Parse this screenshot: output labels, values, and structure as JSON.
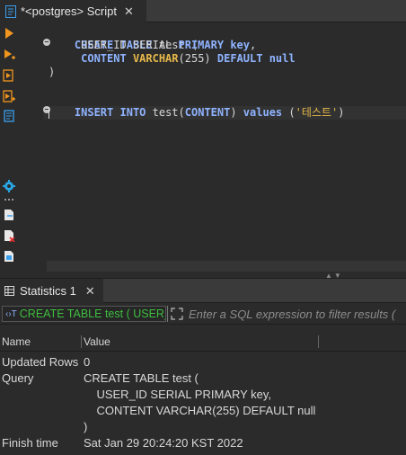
{
  "editor_tab": {
    "title": "*<postgres> Script",
    "close": "✕"
  },
  "toolbar": {
    "top": [
      "execute-statement-icon",
      "execute-in-new-tab-icon",
      "execute-script-icon",
      "execute-script-new-tabs-icon",
      "explain-plan-icon"
    ],
    "bottom": [
      "settings-gear-icon",
      "more-dots-icon",
      "load-script-icon",
      "delete-script-icon",
      "export-script-icon"
    ]
  },
  "code": {
    "line1": {
      "kw1": "CREATE",
      "kw2": "TABLE",
      "rest": " test ("
    },
    "line2": {
      "indent": "     ",
      "col": "USER_ID SERIAL ",
      "kw1": "PRIMARY",
      "kw2": "key",
      "tail": ","
    },
    "line3": {
      "indent": "     ",
      "col": "CONTENT",
      "type": "VARCHAR",
      "len": "(255) ",
      "kw1": "DEFAULT",
      "kw2": "null"
    },
    "line4": ")",
    "line5": {
      "kw1": "INSERT",
      "kw2": "INTO",
      "tbl": " test(",
      "col": "CONTENT",
      "close": ") ",
      "kw3": "values",
      "open": " (",
      "str": "'테스트'",
      "end": ")"
    }
  },
  "results": {
    "tab_label": "Statistics 1",
    "close": "✕",
    "sql_chip_icon": "‹›T",
    "sql_chip_text": "CREATE TABLE test ( USER_ID",
    "filter_placeholder": "Enter a SQL expression to filter results (",
    "columns": [
      "Name",
      "Value"
    ],
    "rows": {
      "updated": {
        "name": "Updated Rows",
        "value": "0"
      },
      "query": {
        "name": "Query",
        "lines": [
          "CREATE TABLE test (",
          "    USER_ID SERIAL PRIMARY key,",
          "    CONTENT VARCHAR(255) DEFAULT null",
          ")"
        ]
      },
      "finish": {
        "name": "Finish time",
        "value": "Sat Jan 29 20:24:20 KST 2022"
      }
    }
  },
  "colors": {
    "keyword": "#8fb3ff",
    "type": "#e6b84a",
    "string": "#e6b84a",
    "sql_chip_text": "#3fbf3f",
    "exec_orange": "#f0961e",
    "settings_blue": "#2aa8e8"
  }
}
